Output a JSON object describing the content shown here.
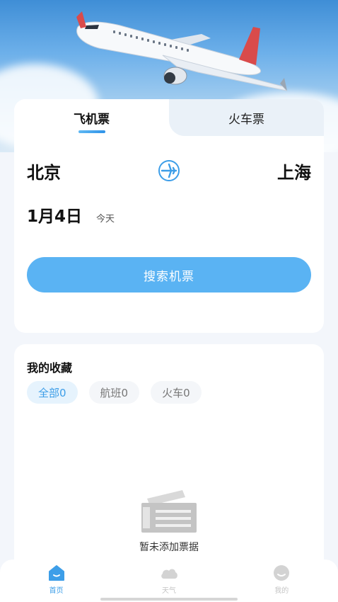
{
  "tabs": {
    "flight": "飞机票",
    "train": "火车票"
  },
  "route": {
    "from": "北京",
    "to": "上海",
    "swap_icon": "plane-circle-icon"
  },
  "date": {
    "value": "1月4日",
    "hint": "今天"
  },
  "search": {
    "label": "搜索机票"
  },
  "favorites": {
    "title": "我的收藏",
    "chips": [
      "全部0",
      "航班0",
      "火车0"
    ],
    "empty_text": "暂未添加票据",
    "empty_icon": "ticket-stack-icon"
  },
  "nav": [
    {
      "label": "首页",
      "icon": "home-icon",
      "active": true
    },
    {
      "label": "天气",
      "icon": "cloud-icon",
      "active": false
    },
    {
      "label": "我的",
      "icon": "smile-icon",
      "active": false
    }
  ],
  "colors": {
    "accent": "#5ab3f3",
    "accent_text": "#3d9ee8",
    "chip_active_bg": "#e6f3fd"
  }
}
